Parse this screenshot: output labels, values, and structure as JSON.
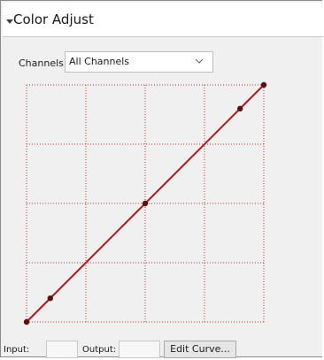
{
  "panel": {
    "title": "Color Adjust"
  },
  "channels": {
    "label": "Channels:",
    "selected": "All Channels"
  },
  "curve": {
    "grid_color": "#c03030",
    "line_color": "#b01818",
    "point_color": "#5a1010",
    "control_points": [
      {
        "input": 0,
        "output": 0
      },
      {
        "input": 0.1,
        "output": 0.1
      },
      {
        "input": 0.5,
        "output": 0.5
      },
      {
        "input": 0.9,
        "output": 0.9
      },
      {
        "input": 1,
        "output": 1
      }
    ]
  },
  "footer": {
    "input_label": "Input:",
    "input_value": "",
    "output_label": "Output:",
    "output_value": "",
    "edit_curve_label": "Edit Curve..."
  }
}
